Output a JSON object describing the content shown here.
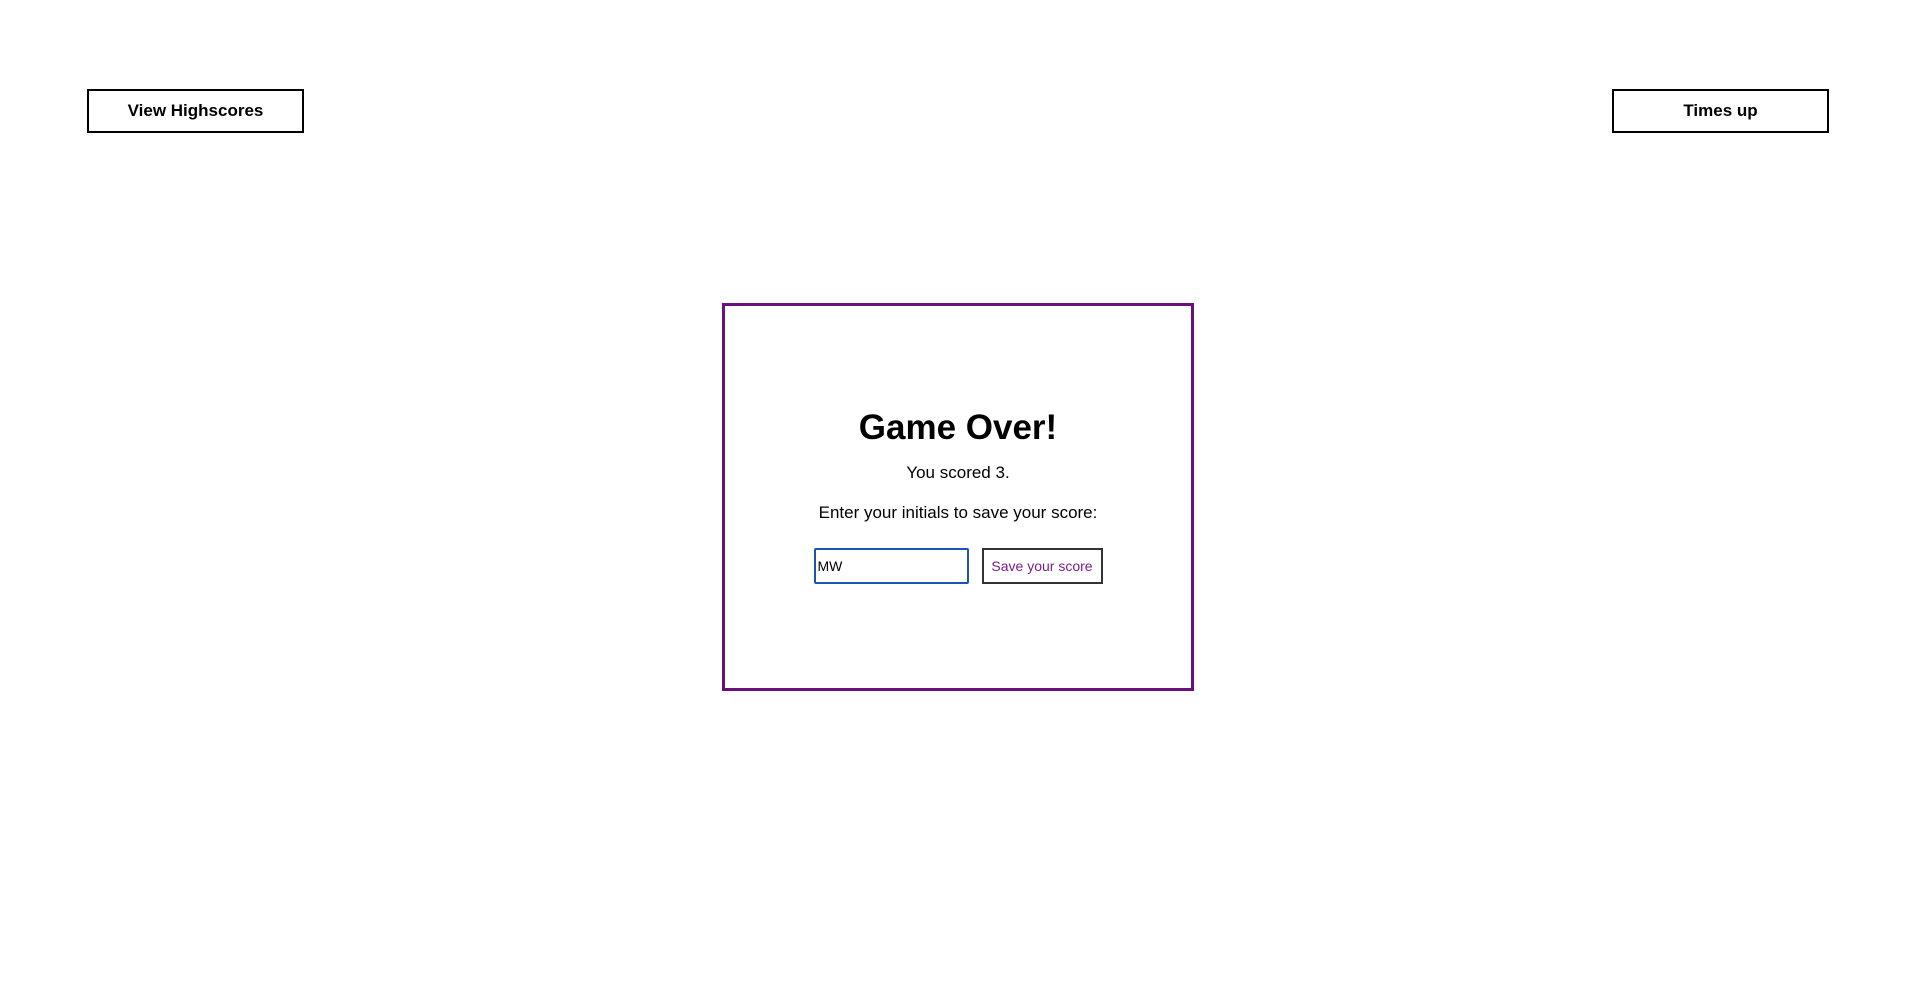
{
  "header": {
    "highscores_label": "View Highscores",
    "timer_label": "Times up"
  },
  "game_over": {
    "title": "Game Over!",
    "score_text": "You scored 3.",
    "prompt": "Enter your initials to save your score:",
    "initials_value": "MW",
    "save_label": "Save your score"
  },
  "colors": {
    "card_border": "#6a0f7e",
    "save_button_text": "#7a1e8c",
    "input_focus_border": "#1a56b0"
  }
}
